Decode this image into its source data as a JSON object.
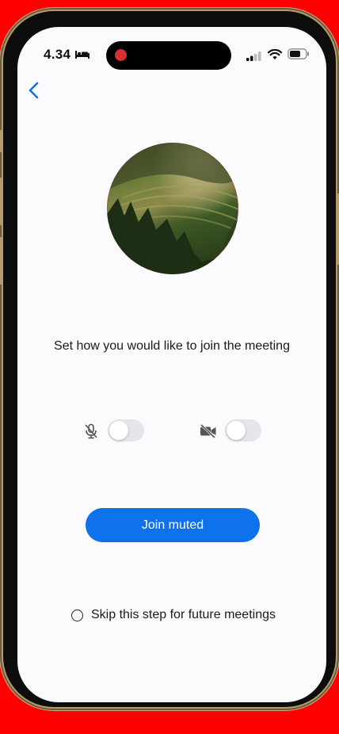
{
  "status_bar": {
    "time": "4.34"
  },
  "main": {
    "prompt": "Set how you would like to join the meeting",
    "join_button": "Join muted",
    "skip_label": "Skip this step for future meetings",
    "audio_toggle_on": false,
    "video_toggle_on": false
  },
  "colors": {
    "accent": "#0e72ed",
    "background_frame": "#ff0000",
    "screen_bg": "#fbfbfd",
    "toggle_off": "#e6e6ea"
  },
  "icons": [
    "chevron-left-icon",
    "mic-off-icon",
    "video-off-icon",
    "signal-icon",
    "wifi-icon",
    "battery-icon",
    "bed-icon"
  ]
}
